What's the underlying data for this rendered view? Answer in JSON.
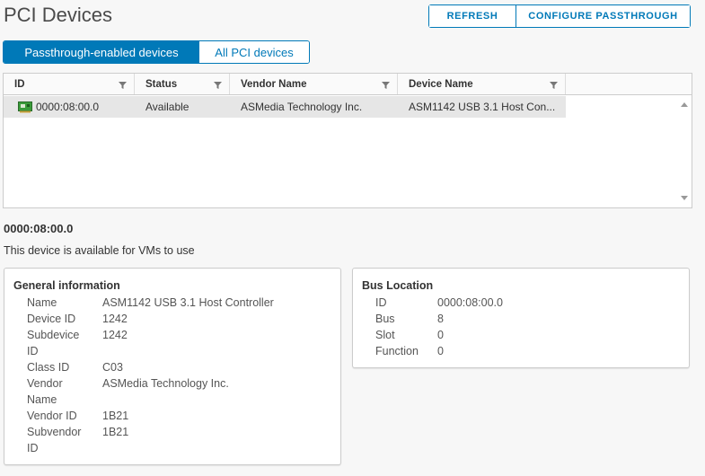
{
  "header": {
    "title": "PCI Devices",
    "refresh_label": "REFRESH",
    "configure_label": "CONFIGURE PASSTHROUGH"
  },
  "tabs": [
    {
      "label": "Passthrough-enabled devices",
      "active": true
    },
    {
      "label": "All PCI devices",
      "active": false
    }
  ],
  "grid": {
    "columns": [
      "ID",
      "Status",
      "Vendor Name",
      "Device Name"
    ],
    "rows": [
      {
        "id": "0000:08:00.0",
        "status": "Available",
        "vendor": "ASMedia Technology Inc.",
        "device": "ASM1142 USB 3.1 Host Con..."
      }
    ]
  },
  "detail": {
    "title": "0000:08:00.0",
    "description": "This device is available for VMs to use",
    "general": {
      "title": "General information",
      "name_label": "Name",
      "name_value": "ASM1142 USB 3.1 Host Controller",
      "device_id_label": "Device ID",
      "device_id_value": "1242",
      "subdevice_label_1": "Subdevice",
      "subdevice_label_2": "ID",
      "subdevice_value": "1242",
      "class_id_label": "Class ID",
      "class_id_value": "C03",
      "vendor_label_1": "Vendor",
      "vendor_label_2": "Name",
      "vendor_value": "ASMedia Technology Inc.",
      "vendor_id_label": "Vendor ID",
      "vendor_id_value": "1B21",
      "subvendor_label_1": "Subvendor",
      "subvendor_label_2": "ID",
      "subvendor_value": "1B21"
    },
    "bus": {
      "title": "Bus Location",
      "id_label": "ID",
      "id_value": "0000:08:00.0",
      "bus_label": "Bus",
      "bus_value": "8",
      "slot_label": "Slot",
      "slot_value": "0",
      "function_label": "Function",
      "function_value": "0"
    }
  },
  "colors": {
    "accent": "#0079b8",
    "selected_row": "#e6e6e6"
  }
}
